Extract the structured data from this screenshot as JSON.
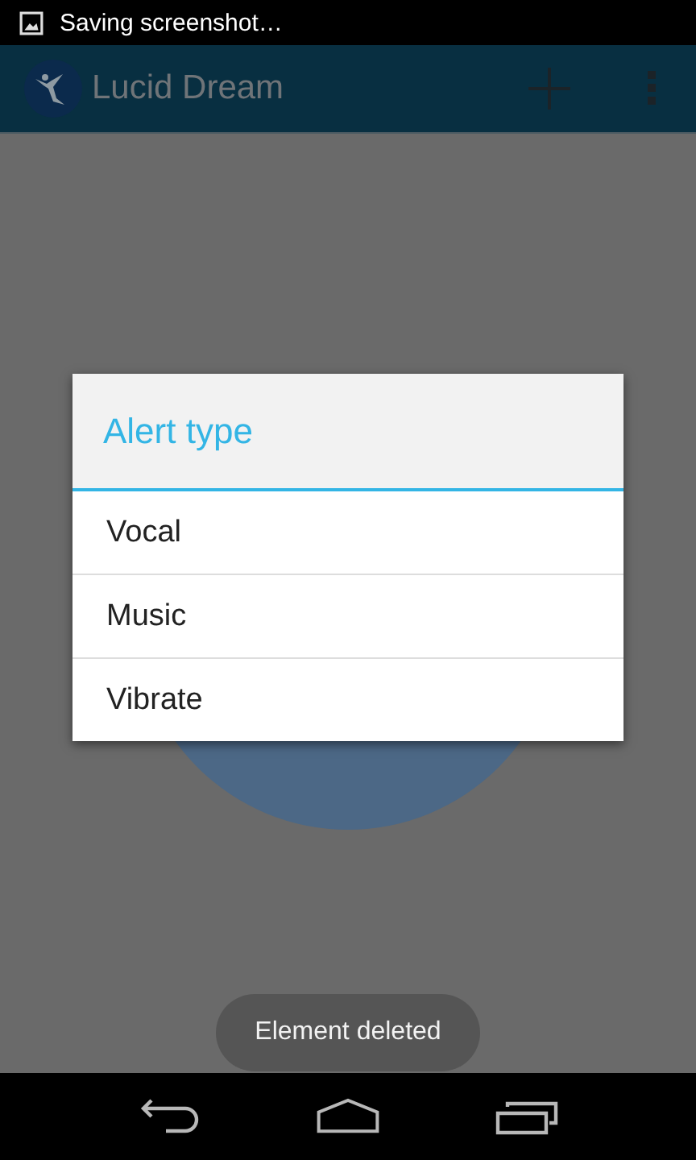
{
  "status_bar": {
    "notification": "Saving screenshot…"
  },
  "app_bar": {
    "title": "Lucid Dream"
  },
  "dialog": {
    "title": "Alert type",
    "options": [
      "Vocal",
      "Music",
      "Vibrate"
    ]
  },
  "toast": {
    "text": "Element deleted"
  }
}
